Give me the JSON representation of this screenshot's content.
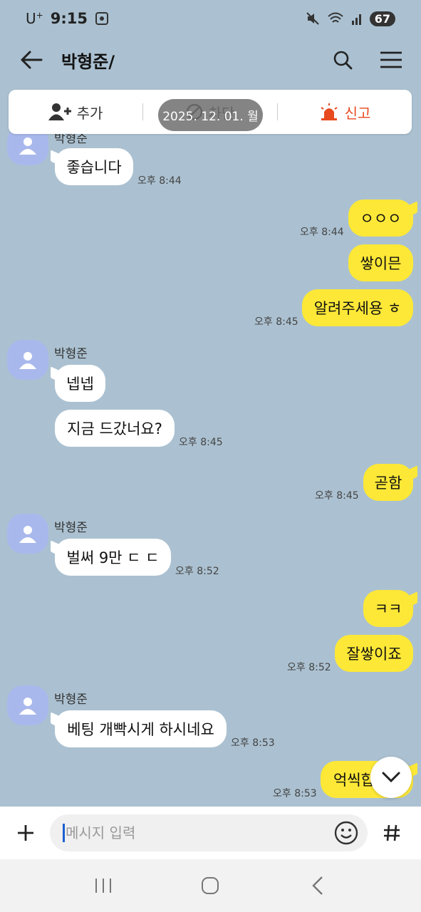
{
  "status_bar": {
    "carrier": "U",
    "carrier_sup": "+",
    "time": "9:15",
    "battery": "67"
  },
  "header": {
    "title": "박형준/"
  },
  "actions": {
    "add": "추가",
    "block": "차단",
    "report": "신고"
  },
  "date_pill": "2025. 12. 01. 월",
  "messages": [
    {
      "dir": "in",
      "text": "좋습니다",
      "time": "오후 8:44"
    },
    {
      "dir": "out",
      "text": "ㅇㅇㅇ",
      "time": "오후 8:44"
    },
    {
      "dir": "out",
      "text": "쌓이믄",
      "time": ""
    },
    {
      "dir": "out",
      "text": "알려주세용 ㅎ",
      "time": "오후 8:45"
    },
    {
      "dir": "in",
      "sender": "박형준",
      "text": "넵넵",
      "time": ""
    },
    {
      "dir": "in",
      "text": "지금 드갔너요?",
      "time": "오후 8:45"
    },
    {
      "dir": "out",
      "text": "곧함",
      "time": "오후 8:45"
    },
    {
      "dir": "in",
      "sender": "박형준",
      "text": "벌써 9만 ㄷ ㄷ",
      "time": "오후 8:52"
    },
    {
      "dir": "out",
      "text": "ㅋㅋ",
      "time": ""
    },
    {
      "dir": "out",
      "text": "잘쌓이죠",
      "time": "오후 8:52"
    },
    {
      "dir": "in",
      "sender": "박형준",
      "text": "베팅 개빡시게 하시네요",
      "time": "오후 8:53"
    },
    {
      "dir": "out",
      "text": "억씩합",
      "time": "오후 8:53"
    }
  ],
  "input": {
    "placeholder": "메시지 입력"
  },
  "colors": {
    "background": "#abc1d1",
    "bubble_out": "#fde837",
    "bubble_in": "#ffffff",
    "report": "#e84a1f"
  },
  "icons": [
    "back-arrow-icon",
    "search-icon",
    "menu-icon",
    "add-friend-icon",
    "block-icon",
    "siren-icon",
    "chevron-down-icon",
    "plus-icon",
    "emoji-icon",
    "hash-icon",
    "recent-apps-icon",
    "home-icon",
    "nav-back-icon"
  ]
}
